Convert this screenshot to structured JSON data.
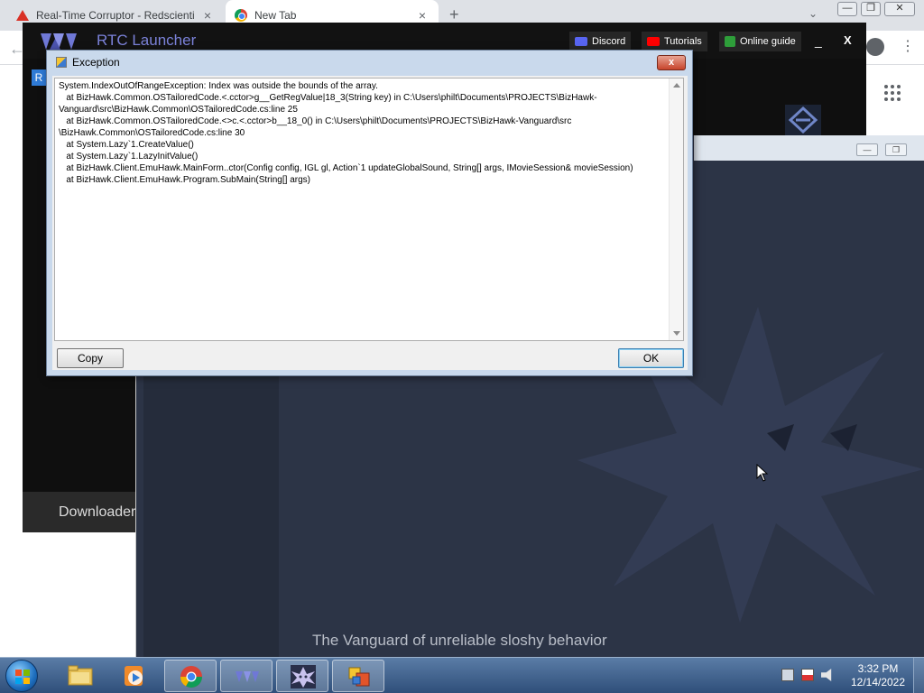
{
  "browser": {
    "tabs": [
      {
        "title": "Real-Time Corruptor - Redscienti",
        "icon": "warning-icon",
        "active": false
      },
      {
        "title": "New Tab",
        "icon": "chrome-icon",
        "active": true
      }
    ],
    "new_tab_symbol": "+",
    "tab_search_symbol": "⌄",
    "window_controls": {
      "minimize": "—",
      "maximize": "❐",
      "close": "✕"
    },
    "back_symbol": "←",
    "menu_symbol": "⋮"
  },
  "rtc_launcher": {
    "title": "RTC Launcher",
    "buttons": [
      {
        "label": "Discord",
        "icon": "discord-icon",
        "color": "#5865f2"
      },
      {
        "label": "Tutorials",
        "icon": "youtube-icon",
        "color": "#ff0000"
      },
      {
        "label": "Online guide",
        "icon": "guide-icon",
        "color": "#2e9e3a"
      }
    ],
    "minimize": "_",
    "close": "X",
    "badge": "R",
    "footer_label": "Downloader"
  },
  "vanguard": {
    "tagline": "The Vanguard of unreliable sloshy behavior",
    "window_controls": {
      "minimize": "—",
      "maximize": "❐"
    }
  },
  "dialog": {
    "title": "Exception",
    "close_symbol": "x",
    "lines": [
      "System.IndexOutOfRangeException: Index was outside the bounds of the array.",
      "   at BizHawk.Common.OSTailoredCode.<.cctor>g__GetRegValue|18_3(String key) in C:\\Users\\philt\\Documents\\PROJECTS\\BizHawk-",
      "Vanguard\\src\\BizHawk.Common\\OSTailoredCode.cs:line 25",
      "   at BizHawk.Common.OSTailoredCode.<>c.<.cctor>b__18_0() in C:\\Users\\philt\\Documents\\PROJECTS\\BizHawk-Vanguard\\src",
      "\\BizHawk.Common\\OSTailoredCode.cs:line 30",
      "   at System.Lazy`1.CreateValue()",
      "   at System.Lazy`1.LazyInitValue()",
      "   at BizHawk.Client.EmuHawk.MainForm..ctor(Config config, IGL gl, Action`1 updateGlobalSound, String[] args, IMovieSession& movieSession)",
      "   at BizHawk.Client.EmuHawk.Program.SubMain(String[] args)"
    ],
    "copy_label": "Copy",
    "ok_label": "OK"
  },
  "taskbar": {
    "apps": [
      {
        "name": "explorer",
        "icon": "folder-icon",
        "active": false
      },
      {
        "name": "media-player",
        "icon": "media-player-icon",
        "active": false
      },
      {
        "name": "chrome",
        "icon": "chrome-icon",
        "active": true
      },
      {
        "name": "rtc-launcher",
        "icon": "rtc-icon",
        "active": true
      },
      {
        "name": "vanguard",
        "icon": "vanguard-icon",
        "active": true
      },
      {
        "name": "exception-dialog",
        "icon": "dialog-icon",
        "active": true
      }
    ],
    "time": "3:32 PM",
    "date": "12/14/2022"
  }
}
